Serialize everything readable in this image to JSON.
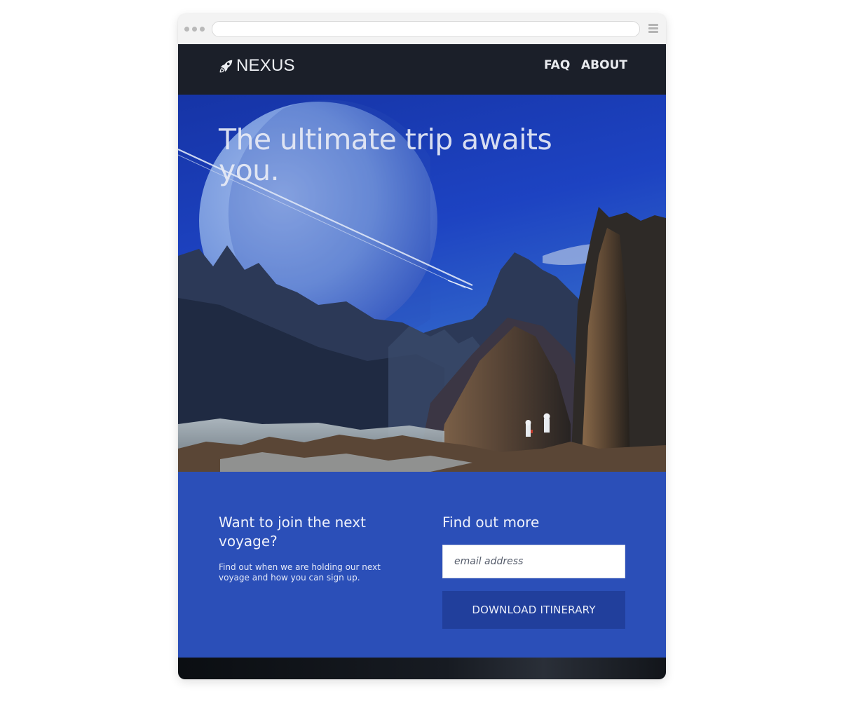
{
  "nav": {
    "brand": "NEXUS",
    "links": [
      {
        "label": "FAQ"
      },
      {
        "label": "ABOUT"
      }
    ]
  },
  "hero": {
    "title": "The ultimate trip awaits you."
  },
  "cta": {
    "heading": "Want to join the next voyage?",
    "text": "Find out when we are holding our next voyage and how you can sign up.",
    "form_heading": "Find out more",
    "email_placeholder": "email address",
    "button_label": "DOWNLOAD ITINERARY"
  },
  "colors": {
    "navbar": "#1b1f29",
    "cta_background": "#2b4fb8",
    "button_background": "#213f9c"
  }
}
